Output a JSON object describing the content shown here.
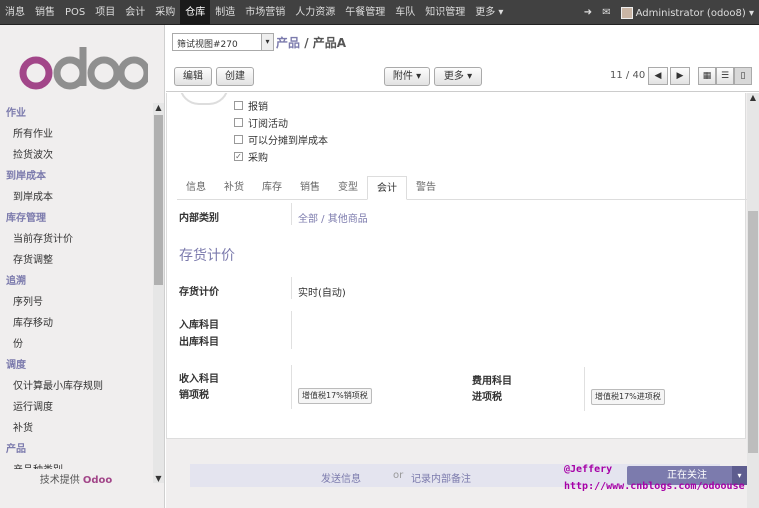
{
  "topbar": {
    "menu": [
      "消息",
      "销售",
      "POS",
      "项目",
      "会计",
      "采购",
      "仓库",
      "制造",
      "市场营销",
      "人力资源",
      "午餐管理",
      "车队",
      "知识管理",
      "更多 ▾"
    ],
    "active": "仓库",
    "user": "Administrator (odoo8) ▾"
  },
  "sidebar": {
    "logo": "odoo",
    "sections": [
      {
        "title": "作业",
        "items": [
          "所有作业",
          "捡货波次"
        ]
      },
      {
        "title": "到岸成本",
        "items": [
          "到岸成本"
        ]
      },
      {
        "title": "库存管理",
        "items": [
          "当前存货计价",
          "存货调整"
        ]
      },
      {
        "title": "追溯",
        "items": [
          "序列号",
          "库存移动",
          "份"
        ]
      },
      {
        "title": "调度",
        "items": [
          "仅计算最小库存规则",
          "运行调度",
          "补货"
        ]
      },
      {
        "title": "产品",
        "items": [
          "产品种类别"
        ]
      }
    ],
    "powered_prefix": "技术提供",
    "powered_brand": "Odoo"
  },
  "control": {
    "view_select": "筛试视图#270",
    "breadcrumb_link": "产品",
    "breadcrumb_sep": " / ",
    "breadcrumb_current": "产品A",
    "edit": "编辑",
    "create": "创建",
    "attachment": "附件 ▾",
    "more": "更多 ▾",
    "pager": "11 / 40"
  },
  "form": {
    "checkboxes": [
      {
        "label": "报销",
        "checked": false
      },
      {
        "label": "订阅活动",
        "checked": false
      },
      {
        "label": "可以分摊到岸成本",
        "checked": false
      },
      {
        "label": "采购",
        "checked": true
      }
    ],
    "tabs": [
      "信息",
      "补货",
      "库存",
      "销售",
      "变型",
      "会计",
      "警告"
    ],
    "active_tab": "会计",
    "internal_category_label": "内部类别",
    "internal_category_value": "全部 / 其他商品",
    "section_title": "存货计价",
    "valuation_label": "存货计价",
    "valuation_value": "实时(自动)",
    "stock_input_label": "入库科目",
    "stock_output_label": "出库科目",
    "income_label": "收入科目",
    "sales_tax_label": "销项税",
    "sales_tax_value": "增值税17%销项税",
    "expense_label": "费用科目",
    "purchase_tax_label": "进项税",
    "purchase_tax_value": "增值税17%进项税"
  },
  "chatter": {
    "send": "发送信息",
    "or": "or",
    "note": "记录内部备注",
    "follow": "正在关注"
  },
  "watermark": {
    "line1": "@Jeffery",
    "line2": "http://www.cnblogs.com/odoouse"
  },
  "colors": {
    "accent": "#7c7bad",
    "topbar": "#414141",
    "watermark": "#a600a6"
  }
}
